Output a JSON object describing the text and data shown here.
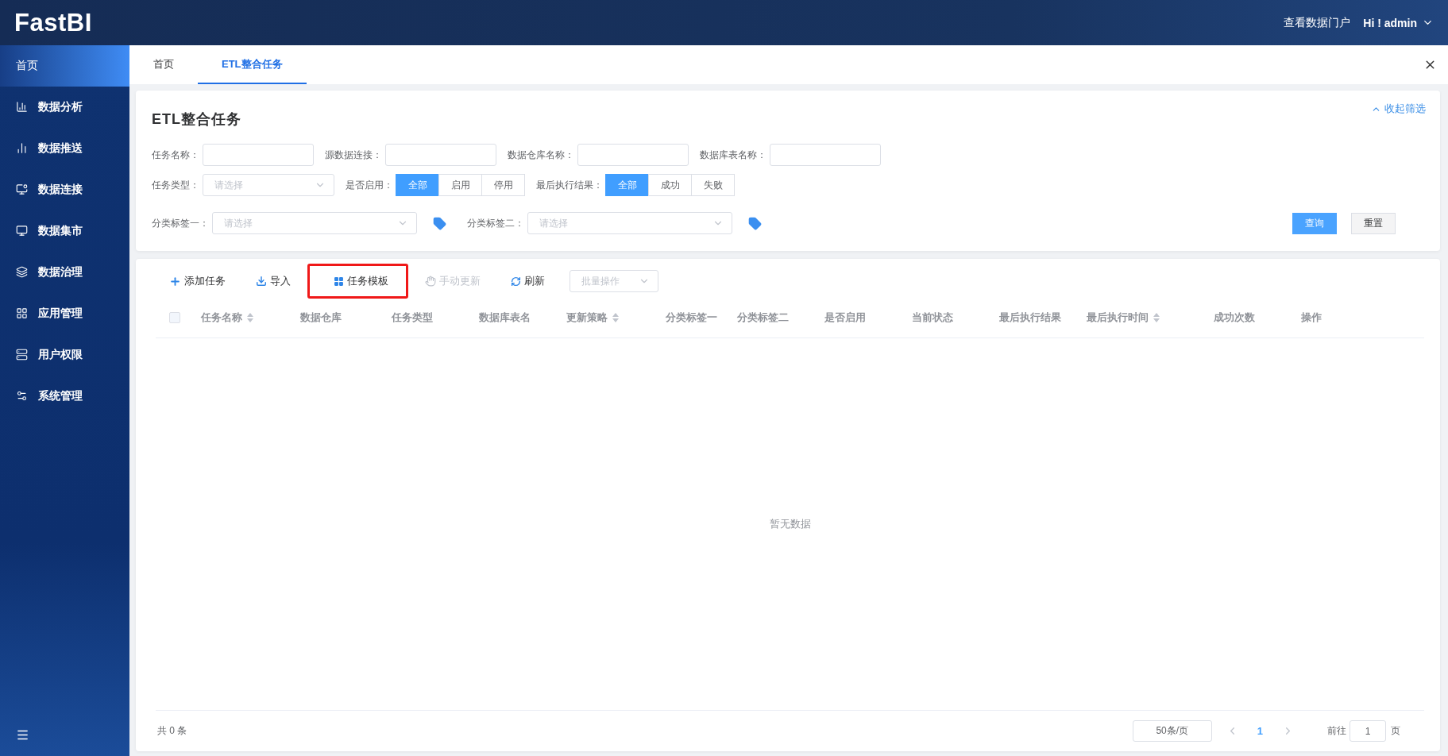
{
  "header": {
    "logo": "FastBI",
    "portal_link": "查看数据门户",
    "user": "Hi ! admin"
  },
  "sidebar": {
    "items": [
      {
        "label": "首页",
        "selected": true
      },
      {
        "label": "数据分析",
        "selected": false
      },
      {
        "label": "数据推送",
        "selected": false
      },
      {
        "label": "数据连接",
        "selected": false
      },
      {
        "label": "数据集市",
        "selected": false
      },
      {
        "label": "数据治理",
        "selected": false
      },
      {
        "label": "应用管理",
        "selected": false
      },
      {
        "label": "用户权限",
        "selected": false
      },
      {
        "label": "系统管理",
        "selected": false
      }
    ]
  },
  "tabs": [
    {
      "label": "首页",
      "selected": false
    },
    {
      "label": "ETL整合任务",
      "selected": true
    }
  ],
  "filter": {
    "title": "ETL整合任务",
    "collapse_link": "收起筛选",
    "rows": [
      [
        {
          "kind": "input",
          "label": "任务名称："
        },
        {
          "kind": "input",
          "label": "源数据连接："
        },
        {
          "kind": "input",
          "label": "数据仓库名称："
        },
        {
          "kind": "input",
          "label": "数据库表名称："
        }
      ],
      [
        {
          "kind": "select",
          "label": "任务类型：",
          "placeholder": "请选择"
        },
        {
          "kind": "segmented",
          "label": "是否启用：",
          "options": [
            {
              "label": "全部",
              "selected": true
            },
            {
              "label": "启用",
              "selected": false
            },
            {
              "label": "停用",
              "selected": false
            }
          ]
        },
        {
          "kind": "segmented",
          "label": "最后执行结果：",
          "options": [
            {
              "label": "全部",
              "selected": true
            },
            {
              "label": "成功",
              "selected": false
            },
            {
              "label": "失败",
              "selected": false
            }
          ]
        }
      ],
      [
        {
          "kind": "tag-select",
          "label": "分类标签一：",
          "placeholder": "请选择"
        },
        {
          "kind": "tag-select",
          "label": "分类标签二：",
          "placeholder": "请选择"
        }
      ]
    ],
    "buttons": [
      {
        "label": "查询",
        "kind": "primary"
      },
      {
        "label": "重置",
        "kind": "default"
      }
    ]
  },
  "toolbar": {
    "items": [
      {
        "label": "添加任务",
        "disabled": false,
        "highlighted": false
      },
      {
        "label": "导入",
        "disabled": false,
        "highlighted": false
      },
      {
        "label": "任务模板",
        "disabled": false,
        "highlighted": true
      },
      {
        "label": "手动更新",
        "disabled": true,
        "highlighted": false
      },
      {
        "label": "刷新",
        "disabled": false,
        "highlighted": false
      }
    ],
    "batch_select": {
      "placeholder": "批量操作"
    }
  },
  "table": {
    "select_all_checked": false,
    "columns": [
      {
        "label": "任务名称",
        "sortable": true
      },
      {
        "label": "数据仓库",
        "sortable": false
      },
      {
        "label": "任务类型",
        "sortable": false
      },
      {
        "label": "数据库表名",
        "sortable": false
      },
      {
        "label": "更新策略",
        "sortable": true
      },
      {
        "label": "分类标签一",
        "sortable": false
      },
      {
        "label": "分类标签二",
        "sortable": false
      },
      {
        "label": "是否启用",
        "sortable": false
      },
      {
        "label": "当前状态",
        "sortable": false
      },
      {
        "label": "最后执行结果",
        "sortable": false
      },
      {
        "label": "最后执行时间",
        "sortable": true
      },
      {
        "label": "成功次数",
        "sortable": false
      },
      {
        "label": "操作",
        "sortable": false
      }
    ],
    "empty_text": "暂无数据"
  },
  "pagination": {
    "total": "共 0 条",
    "page_size": "50条/页",
    "pages": [
      {
        "label": "1",
        "selected": true
      }
    ],
    "goto_label": "前往",
    "goto_value": "1",
    "page_unit": "页"
  }
}
